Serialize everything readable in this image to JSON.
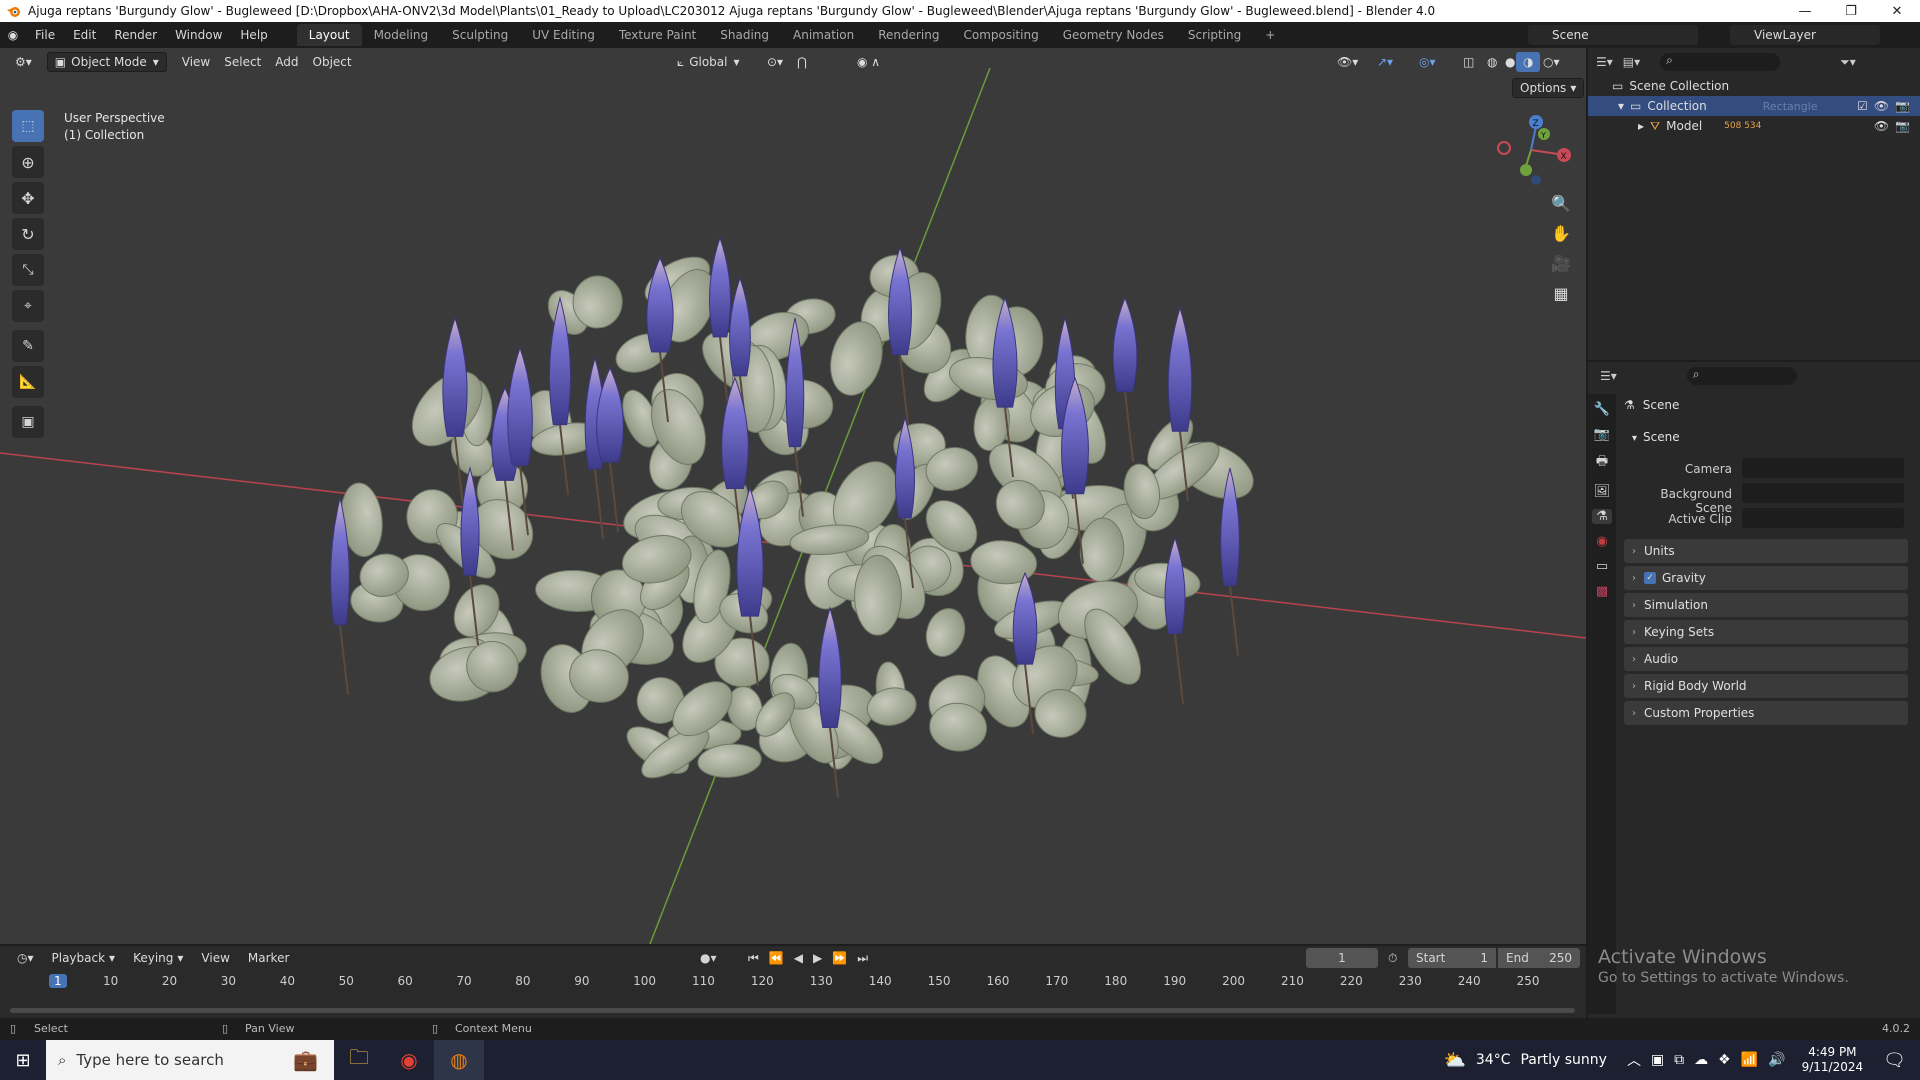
{
  "window": {
    "title": "Ajuga reptans 'Burgundy Glow' - Bugleweed [D:\\Dropbox\\AHA-ONV2\\3d Model\\Plants\\01_Ready to Upload\\LC203012 Ajuga reptans 'Burgundy Glow' - Bugleweed\\Blender\\Ajuga reptans 'Burgundy Glow' - Bugleweed.blend] - Blender 4.0",
    "buttons": [
      "—",
      "❐",
      "✕"
    ]
  },
  "menu": [
    "File",
    "Edit",
    "Render",
    "Window",
    "Help"
  ],
  "workspaces": [
    "Layout",
    "Modeling",
    "Sculpting",
    "UV Editing",
    "Texture Paint",
    "Shading",
    "Animation",
    "Rendering",
    "Compositing",
    "Geometry Nodes",
    "Scripting",
    "+"
  ],
  "active_workspace": "Layout",
  "scene_field": "Scene",
  "viewlayer_field": "ViewLayer",
  "viewport": {
    "mode": "Object Mode",
    "menus": [
      "View",
      "Select",
      "Add",
      "Object"
    ],
    "transform_orientation": "Global",
    "options": "Options",
    "overlay_line1": "User Perspective",
    "overlay_line2": "(1) Collection",
    "gizmo": {
      "x": "X",
      "y": "Y",
      "z": "Z"
    },
    "colors": {
      "bg": "#3a3a3a",
      "x_axis": "#b8434f",
      "y_axis": "#6a9c3a",
      "flower": "#5a58c0",
      "leaf": "#a5ab98"
    }
  },
  "outliner": {
    "root": "Scene Collection",
    "collection": "Collection",
    "collection_child_hint": "Rectangle",
    "model": "Model",
    "model_badge": "508 534"
  },
  "properties": {
    "header": "Scene",
    "section": "Scene",
    "rows": [
      {
        "label": "Camera"
      },
      {
        "label": "Background Scene"
      },
      {
        "label": "Active Clip"
      }
    ],
    "panels": [
      "Units",
      "Gravity",
      "Simulation",
      "Keying Sets",
      "Audio",
      "Rigid Body World",
      "Custom Properties"
    ],
    "gravity_checked": true
  },
  "timeline": {
    "menus": [
      "Playback",
      "Keying",
      "View",
      "Marker"
    ],
    "current_frame": "1",
    "start_label": "Start",
    "start": "1",
    "end_label": "End",
    "end": "250",
    "ticks": [
      "1",
      "10",
      "20",
      "30",
      "40",
      "50",
      "60",
      "70",
      "80",
      "90",
      "100",
      "110",
      "120",
      "130",
      "140",
      "150",
      "160",
      "170",
      "180",
      "190",
      "200",
      "210",
      "220",
      "230",
      "240",
      "250"
    ]
  },
  "activate_windows": {
    "line1": "Activate Windows",
    "line2": "Go to Settings to activate Windows."
  },
  "statusbar": {
    "select": "Select",
    "pan": "Pan View",
    "context": "Context Menu",
    "version": "4.0.2"
  },
  "taskbar": {
    "search_placeholder": "Type here to search",
    "weather_temp": "34°C",
    "weather_text": "Partly sunny",
    "time": "4:49 PM",
    "date": "9/11/2024"
  }
}
